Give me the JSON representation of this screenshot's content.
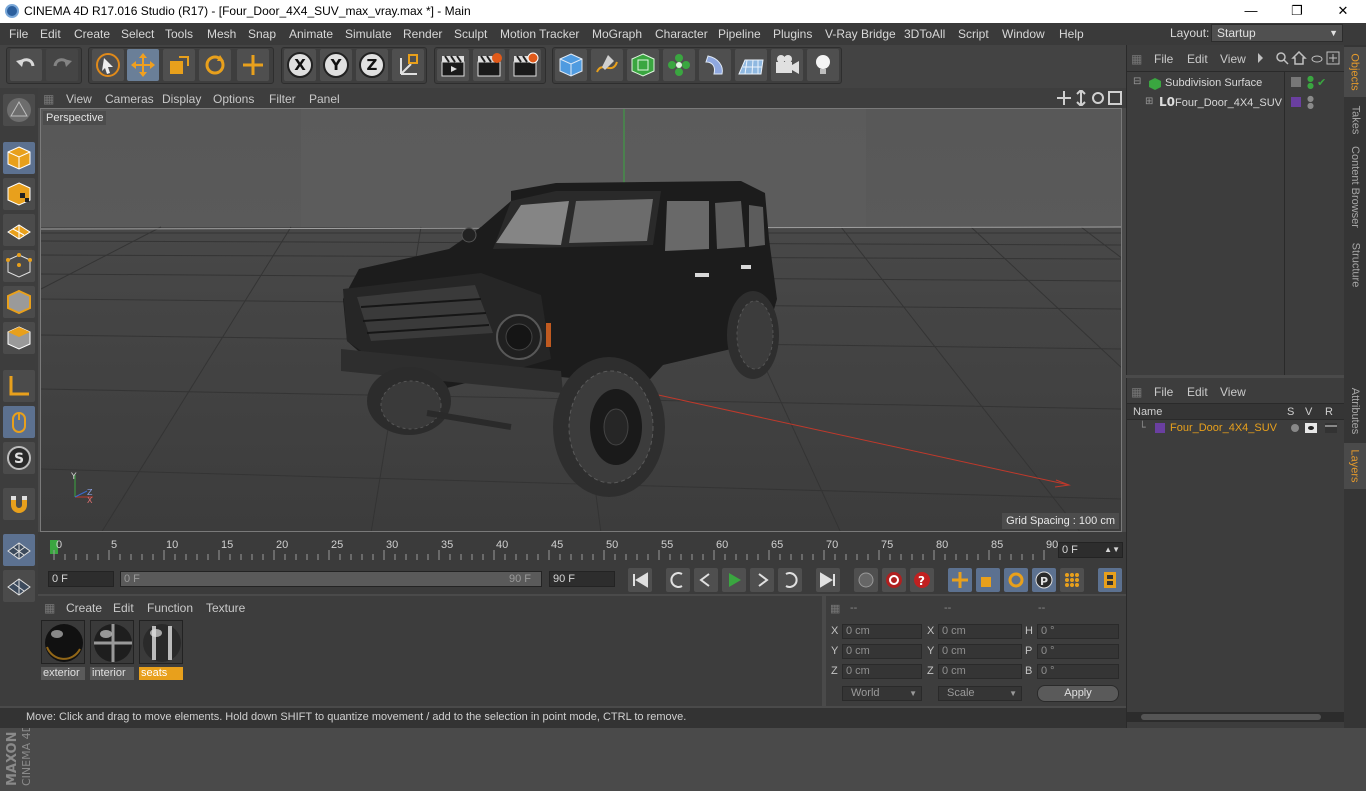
{
  "window": {
    "title": "CINEMA 4D R17.016 Studio (R17) - [Four_Door_4X4_SUV_max_vray.max *] - Main",
    "controls": {
      "minimize": "—",
      "maximize": "❐",
      "close": "✕"
    }
  },
  "menu": {
    "items": [
      "File",
      "Edit",
      "Create",
      "Select",
      "Tools",
      "Mesh",
      "Snap",
      "Animate",
      "Simulate",
      "Render",
      "Sculpt",
      "Motion Tracker",
      "MoGraph",
      "Character",
      "Pipeline",
      "Plugins",
      "V-Ray Bridge",
      "3DToAll",
      "Script",
      "Window",
      "Help"
    ],
    "layout_label": "Layout:",
    "layout_value": "Startup"
  },
  "toolbar": {
    "axis_x": "X",
    "axis_y": "Y",
    "axis_z": "Z"
  },
  "viewport": {
    "menus": [
      "View",
      "Cameras",
      "Display",
      "Options",
      "Filter",
      "Panel"
    ],
    "camera_label": "Perspective",
    "grid_spacing": "Grid Spacing : 100 cm",
    "axis_y": "Y",
    "axis_z": "Z",
    "axis_x": "X"
  },
  "timeline": {
    "ticks": [
      "0",
      "5",
      "10",
      "15",
      "20",
      "25",
      "30",
      "35",
      "40",
      "45",
      "50",
      "55",
      "60",
      "65",
      "70",
      "75",
      "80",
      "85",
      "90"
    ],
    "current_frame": "0 F"
  },
  "transport": {
    "start_field": "0 F",
    "range_start": "0 F",
    "range_end": "90 F",
    "end_field": "90 F"
  },
  "materials": {
    "menus": [
      "Create",
      "Edit",
      "Function",
      "Texture"
    ],
    "items": [
      {
        "name": "exterior",
        "selected": false
      },
      {
        "name": "interior",
        "selected": false
      },
      {
        "name": "seats",
        "selected": true
      }
    ]
  },
  "coordinates": {
    "headers": [
      "--",
      "--",
      "--"
    ],
    "rows": [
      {
        "l1": "X",
        "v1": "0 cm",
        "l2": "X",
        "v2": "0 cm",
        "l3": "H",
        "v3": "0 °"
      },
      {
        "l1": "Y",
        "v1": "0 cm",
        "l2": "Y",
        "v2": "0 cm",
        "l3": "P",
        "v3": "0 °"
      },
      {
        "l1": "Z",
        "v1": "0 cm",
        "l2": "Z",
        "v2": "0 cm",
        "l3": "B",
        "v3": "0 °"
      }
    ],
    "space": "World",
    "mode": "Scale",
    "apply": "Apply"
  },
  "status": "Move: Click and drag to move elements. Hold down SHIFT to quantize movement / add to the selection in point mode, CTRL to remove.",
  "objects_panel": {
    "menus": [
      "File",
      "Edit",
      "View"
    ],
    "items": [
      "Subdivision Surface",
      "Four_Door_4X4_SUV"
    ]
  },
  "layers_panel": {
    "menus": [
      "File",
      "Edit",
      "View"
    ],
    "columns": [
      "Name",
      "S",
      "V",
      "R"
    ],
    "items": [
      "Four_Door_4X4_SUV"
    ]
  },
  "side_tabs": {
    "top": [
      "Objects",
      "Takes",
      "Content Browser",
      "Structure"
    ],
    "bottom": [
      "Attributes",
      "Layers"
    ]
  },
  "brand": {
    "line1": "MAXON",
    "line2": "CINEMA 4D"
  },
  "colors": {
    "accent_orange": "#e8a01c",
    "active_tool_blue": "#5c7190",
    "axis_x_red": "#c0392b",
    "axis_y_green": "#3aa640",
    "layer_purple": "#6a3fa0"
  }
}
